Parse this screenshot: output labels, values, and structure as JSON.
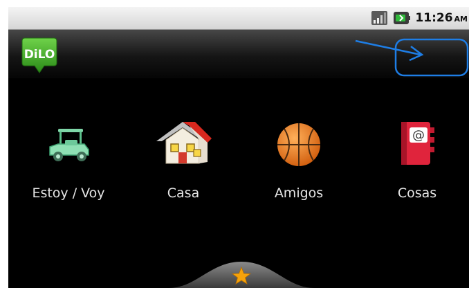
{
  "status_bar": {
    "time": "11:26",
    "ampm": "AM",
    "signal_icon": "signal-bars-icon",
    "battery_icon": "battery-icon"
  },
  "app": {
    "logo_text": "DiLO"
  },
  "categories": [
    {
      "label": "Estoy / Voy",
      "icon": "golf-cart-icon"
    },
    {
      "label": "Casa",
      "icon": "house-icon"
    },
    {
      "label": "Amigos",
      "icon": "basketball-icon"
    },
    {
      "label": "Cosas",
      "icon": "address-book-icon"
    }
  ],
  "bottom_bar": {
    "icon": "star-icon"
  },
  "colors": {
    "annotation": "#1e7ee6",
    "logo_green": "#3a9a22",
    "star": "#f5a20a"
  }
}
